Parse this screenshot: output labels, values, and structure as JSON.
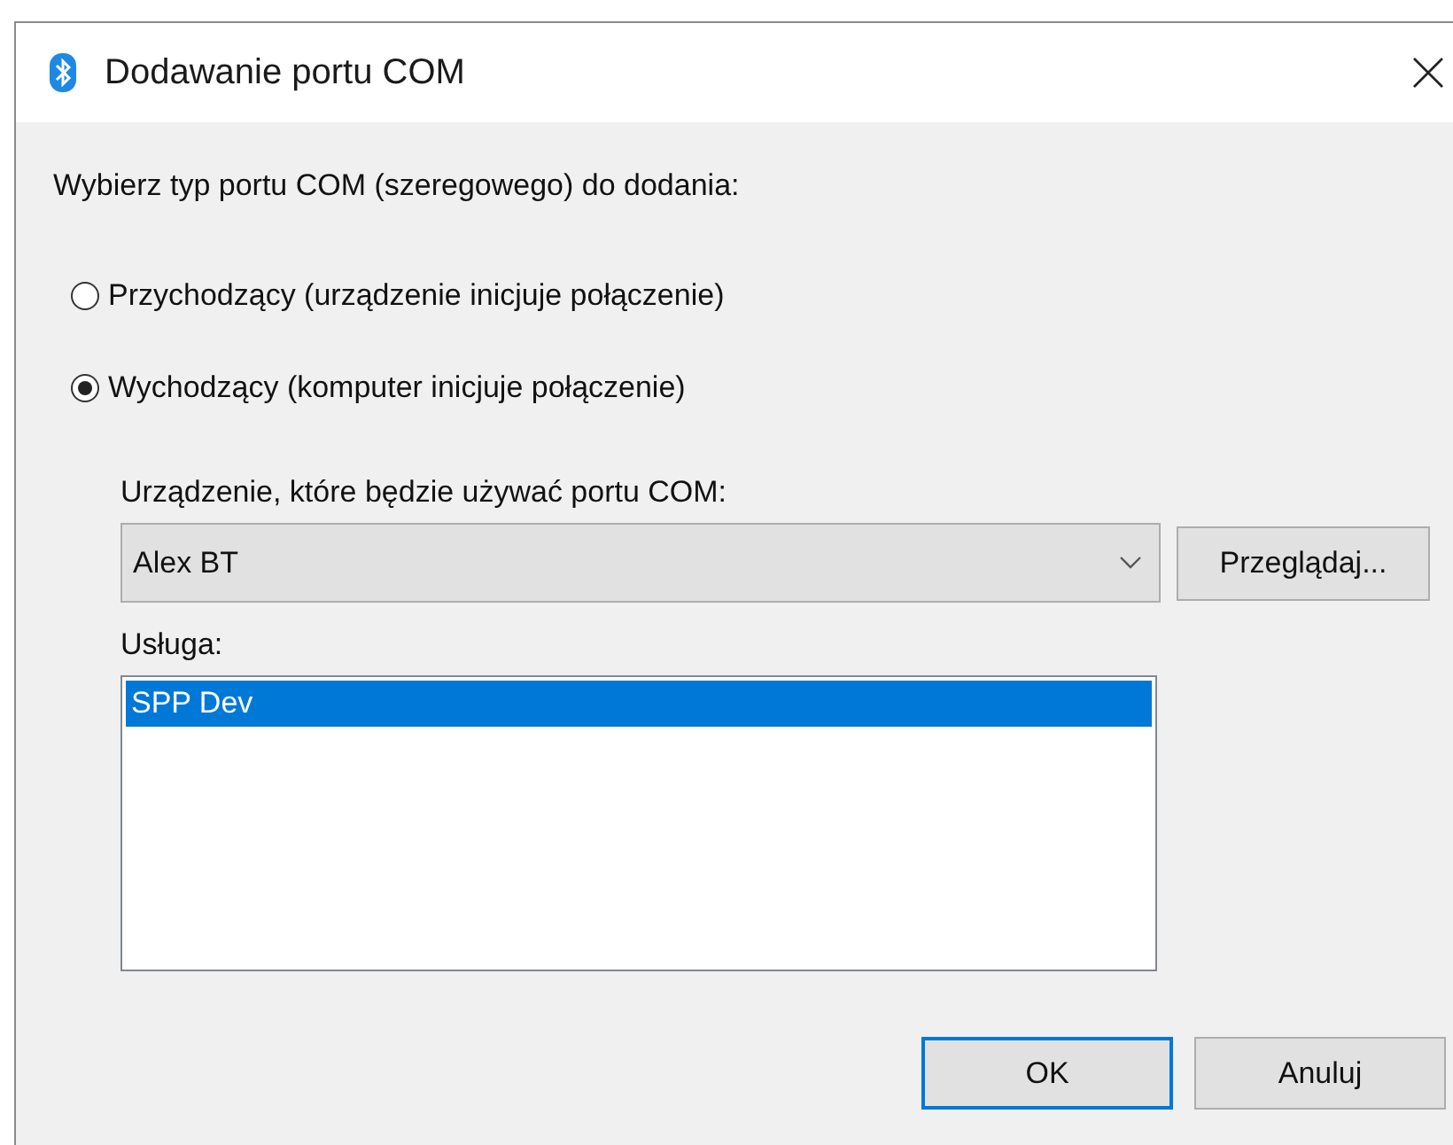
{
  "window": {
    "title": "Dodawanie portu COM"
  },
  "prompt": "Wybierz typ portu COM (szeregowego) do dodania:",
  "port_types": [
    {
      "label": "Przychodzący (urządzenie inicjuje połączenie)",
      "selected": false
    },
    {
      "label": "Wychodzący (komputer inicjuje połączenie)",
      "selected": true
    }
  ],
  "device": {
    "label": "Urządzenie, które będzie używać portu COM:",
    "value": "Alex BT"
  },
  "browse_button": "Przeglądaj...",
  "service": {
    "label": "Usługa:",
    "items": [
      {
        "label": "SPP Dev",
        "selected": true
      }
    ]
  },
  "buttons": [
    {
      "label": "OK",
      "default": true
    },
    {
      "label": "Anuluj",
      "default": false
    }
  ]
}
